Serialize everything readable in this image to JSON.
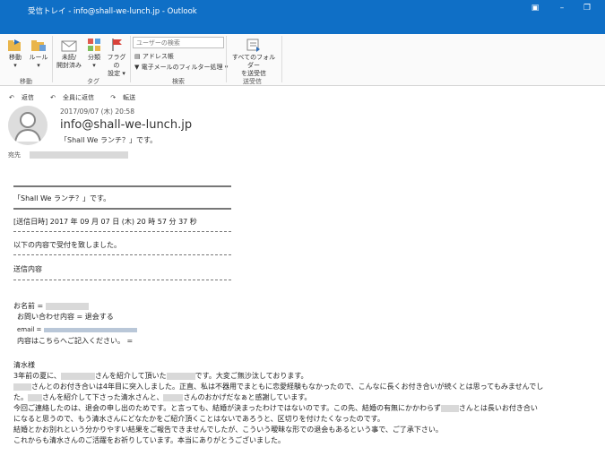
{
  "window": {
    "title": "受信トレイ - info@shall-we-lunch.jp  -  Outlook"
  },
  "ribbon": {
    "move": "移動",
    "rules": "ルール",
    "unread_read": [
      "未読/",
      "開封済み"
    ],
    "categorize": "分類",
    "flag": [
      "フラグの",
      "設定"
    ],
    "user_search_placeholder": "ユーザーの検索",
    "address_book": "アドレス帳",
    "filter_email": "電子メールのフィルター処理",
    "send_receive_all": [
      "すべてのフォルダー",
      "を送受信"
    ],
    "groups": {
      "move": "移動",
      "tags": "タグ",
      "find": "検索",
      "send_receive": "送受信"
    }
  },
  "actions": {
    "reply": "返信",
    "reply_all": "全員に返信",
    "forward": "転送"
  },
  "message": {
    "date": "2017/09/07 (木) 20:58",
    "sender": "info@shall-we-lunch.jp",
    "subject": "「Shall  We  ランチ？」です。",
    "to_label": "宛先"
  },
  "body": {
    "line_subject": "「Shall  We  ランチ？」です。",
    "sent_datetime": "[送信日時] 2017 年 09 月 07 日 (木) 20 時 57 分 37 秒",
    "accepted": "以下の内容で受付を致しました。",
    "send_contents": "送信内容",
    "name_label": "お名前 =",
    "inquiry": "お問い合わせ内容 = 退会する",
    "email_label": "email =",
    "details": "内容はこちらへご記入ください。 =",
    "salutation": "清水様",
    "p1a": "3年前の夏に、",
    "p1b": "さんを紹介して頂いた",
    "p1c": "です。大変ご無沙汰しております。",
    "p2a": "さんとのお付き合いは4年目に突入しました。正直、私は不器用でまともに恋愛経験もなかったので、こんなに長くお付き合いが続くとは思ってもみませんでし",
    "p2b": "た。",
    "p2c": "さんを紹介して下さった清水さんと、",
    "p2d": "さんのおかげだなぁと感謝しています。",
    "p3a": "今回ご連絡したのは、退会の申し出のためです。と言っても、結婚が決まったわけではないのです。この先、結婚の有無にかかわらず",
    "p3b": "さんとは長いお付き合い",
    "p3c": "になると思うので、もう清水さんにどなたかをご紹介頂くことはないであろうと、区切りを付けたくなったのです。",
    "p4": "結婚とかお別れという分かりやすい結果をご報告できませんでしたが、こういう曖昧な形での退会もあるという事で、ご了承下さい。",
    "p5": "これからも清水さんのご活躍をお祈りしています。本当にありがとうございました。"
  }
}
